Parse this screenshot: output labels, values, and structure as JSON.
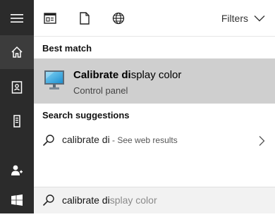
{
  "rail": {
    "items": [
      {
        "icon": "hamburger-menu-icon"
      },
      {
        "icon": "home-icon"
      },
      {
        "icon": "notebook-icon"
      },
      {
        "icon": "tower-icon"
      },
      {
        "icon": "feedback-person-icon"
      },
      {
        "icon": "windows-start-icon"
      }
    ]
  },
  "filters": {
    "label": "Filters",
    "icons": [
      "apps-filter-icon",
      "documents-filter-icon",
      "web-filter-icon"
    ]
  },
  "best_match": {
    "section_label": "Best match",
    "title_typed": "Calibrate di",
    "title_rest": "splay color",
    "subtitle": "Control panel",
    "icon": "monitor-icon"
  },
  "suggestions": {
    "section_label": "Search suggestions",
    "items": [
      {
        "query": "calibrate di",
        "hint": " - See web results"
      }
    ]
  },
  "searchbox": {
    "typed": "calibrate di",
    "ghost": "splay color"
  },
  "colors": {
    "rail_bg": "#2b2b2b",
    "highlight_bg": "#cfcfcf",
    "searchbox_bg": "#f2f2f2"
  }
}
